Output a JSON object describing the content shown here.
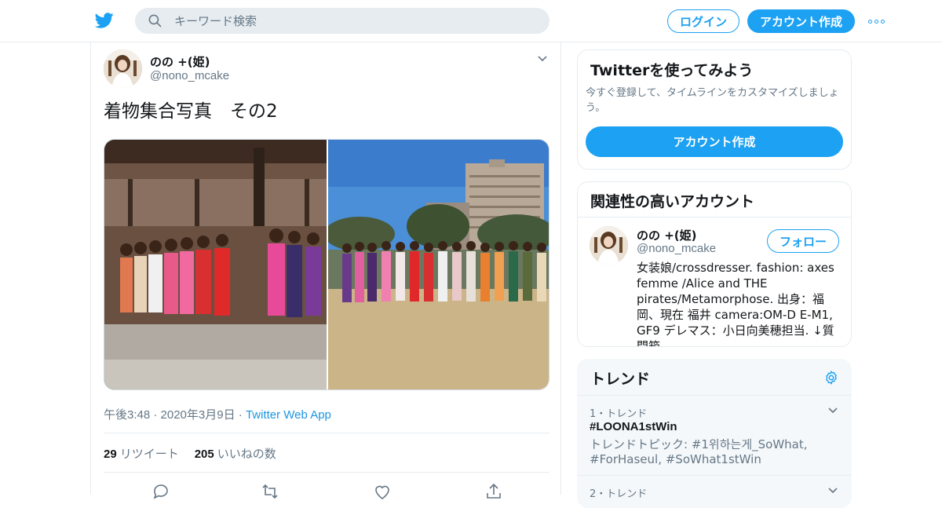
{
  "header": {
    "search_placeholder": "キーワード検索",
    "login_label": "ログイン",
    "signup_label": "アカウント作成"
  },
  "tweet": {
    "display_name": "のの +(姫)",
    "handle": "@nono_mcake",
    "text": "着物集合写真　その2",
    "timestamp": "午後3:48 · 2020年3月9日",
    "separator": "·",
    "source": "Twitter Web App",
    "retweets_count": "29",
    "retweets_label": "リツイート",
    "likes_count": "205",
    "likes_label": "いいねの数"
  },
  "sidebar": {
    "signup_card": {
      "title": "Twitterを使ってみよう",
      "description": "今すぐ登録して、タイムラインをカスタマイズしましょう。",
      "button_label": "アカウント作成"
    },
    "related_card": {
      "title": "関連性の高いアカウント",
      "account": {
        "display_name": "のの +(姫)",
        "handle": "@nono_mcake",
        "follow_label": "フォロー",
        "bio": "女装娘/crossdresser. fashion: axes femme /Alice and THE pirates/Metamorphose. 出身：福岡、現在 福井 camera:OM-D E-M1, GF9 デレマス：小日向美穂担当. ↓質問箱"
      }
    },
    "trends_card": {
      "title": "トレンド",
      "trends": [
        {
          "rank": "1・トレンド",
          "name": "#LOONA1stWin",
          "topic": "トレンドトピック: #1위하는게_SoWhat, #ForHaseul, #SoWhat1stWin"
        },
        {
          "rank": "2・トレンド"
        }
      ]
    }
  },
  "colors": {
    "brand_blue": "#1da1f2",
    "link_blue": "#1b95e0",
    "secondary_text": "#657786",
    "border": "#e6ecf0"
  }
}
